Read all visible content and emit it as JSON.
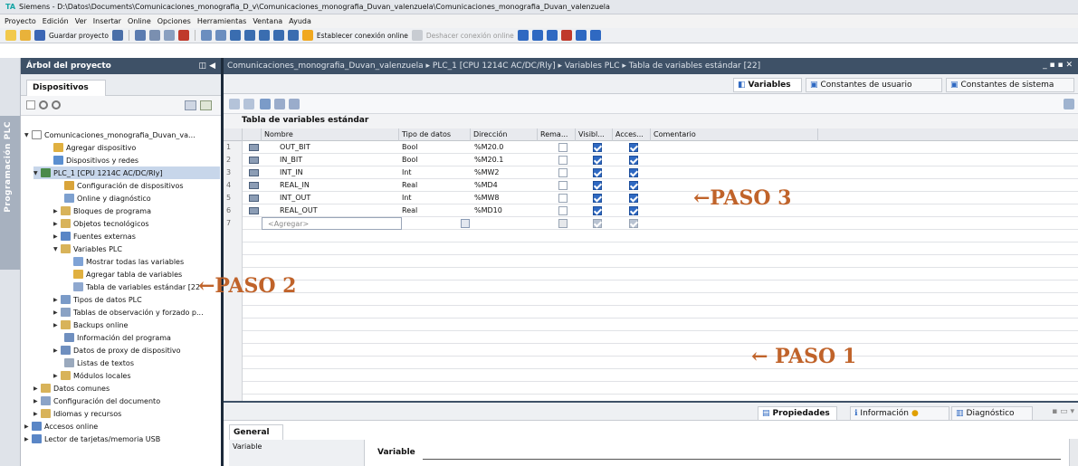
{
  "window": {
    "title": "Siemens  -  D:\\Datos\\Documents\\Comunicaciones_monografia_D_v\\Comunicaciones_monografia_Duvan_valenzuela\\Comunicaciones_monografia_Duvan_valenzuela"
  },
  "menu": [
    "Proyecto",
    "Edición",
    "Ver",
    "Insertar",
    "Online",
    "Opciones",
    "Herramientas",
    "Ventana",
    "Ayuda"
  ],
  "toolbar": {
    "save_label": "Guardar proyecto",
    "connect_label": "Establecer conexión online",
    "disconnect_label": "Deshacer conexión online"
  },
  "side_tab": {
    "label": "Programación PLC"
  },
  "tree_panel": {
    "title": "Árbol del proyecto",
    "tab": "Dispositivos",
    "items": [
      {
        "label": "Comunicaciones_monografia_Duvan_va..."
      },
      {
        "label": "Agregar dispositivo"
      },
      {
        "label": "Dispositivos y redes"
      },
      {
        "label": "PLC_1 [CPU 1214C AC/DC/Rly]"
      },
      {
        "label": "Configuración de dispositivos"
      },
      {
        "label": "Online y diagnóstico"
      },
      {
        "label": "Bloques de programa"
      },
      {
        "label": "Objetos tecnológicos"
      },
      {
        "label": "Fuentes externas"
      },
      {
        "label": "Variables PLC"
      },
      {
        "label": "Mostrar todas las variables"
      },
      {
        "label": "Agregar tabla de variables"
      },
      {
        "label": "Tabla de variables estándar [22"
      },
      {
        "label": "Tipos de datos PLC"
      },
      {
        "label": "Tablas de observación y forzado p..."
      },
      {
        "label": "Backups online"
      },
      {
        "label": "Información del programa"
      },
      {
        "label": "Datos de proxy de dispositivo"
      },
      {
        "label": "Listas de textos"
      },
      {
        "label": "Módulos locales"
      },
      {
        "label": "Datos comunes"
      },
      {
        "label": "Configuración del documento"
      },
      {
        "label": "Idiomas y recursos"
      },
      {
        "label": "Accesos online"
      },
      {
        "label": "Lector de tarjetas/memoria USB"
      }
    ]
  },
  "editor": {
    "breadcrumb": "Comunicaciones_monografia_Duvan_valenzuela  ▸  PLC_1 [CPU 1214C AC/DC/Rly]  ▸  Variables PLC  ▸  Tabla de variables estándar [22]",
    "tabs": [
      "Variables",
      "Constantes de usuario",
      "Constantes de sistema"
    ],
    "table_title": "Tabla de variables estándar",
    "columns": [
      "Nombre",
      "Tipo de datos",
      "Dirección",
      "Rema...",
      "Visibl...",
      "Acces...",
      "Comentario"
    ],
    "rows": [
      {
        "num": "1",
        "name": "OUT_BIT",
        "type": "Bool",
        "address": "%M20.0",
        "retain": false,
        "visible": true,
        "access": true
      },
      {
        "num": "2",
        "name": "IN_BIT",
        "type": "Bool",
        "address": "%M20.1",
        "retain": false,
        "visible": true,
        "access": true
      },
      {
        "num": "3",
        "name": "INT_IN",
        "type": "Int",
        "address": "%MW2",
        "retain": false,
        "visible": true,
        "access": true
      },
      {
        "num": "4",
        "name": "REAL_IN",
        "type": "Real",
        "address": "%MD4",
        "retain": false,
        "visible": true,
        "access": true
      },
      {
        "num": "5",
        "name": "INT_OUT",
        "type": "Int",
        "address": "%MW8",
        "retain": false,
        "visible": true,
        "access": true
      },
      {
        "num": "6",
        "name": "REAL_OUT",
        "type": "Real",
        "address": "%MD10",
        "retain": false,
        "visible": true,
        "access": true
      }
    ],
    "add_row": {
      "num": "7",
      "placeholder": "<Agregar>"
    }
  },
  "annotations": {
    "paso1": "← PASO 1",
    "paso2": "←PASO 2",
    "paso3": "←PASO 3"
  },
  "inspector": {
    "tabs": [
      "Propiedades",
      "Información",
      "Diagnóstico"
    ],
    "general_tab": "General",
    "side_item": "Variable",
    "section_label": "Variable"
  },
  "colors": {
    "header": "#3e5167",
    "accent": "#2f69c2",
    "annotation": "#c0632a",
    "selection": "#c7d6ea"
  }
}
